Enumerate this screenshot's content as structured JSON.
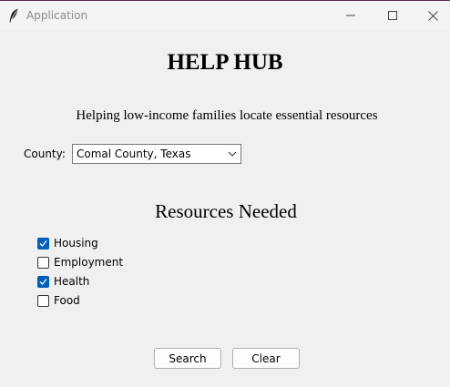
{
  "window": {
    "title": "Application",
    "icons": {
      "app": "feather-icon",
      "minimize": "minimize-icon",
      "maximize": "maximize-icon",
      "close": "close-icon"
    }
  },
  "header": {
    "title": "HELP HUB",
    "subtitle": "Helping low-income families locate essential resources"
  },
  "county": {
    "label": "County:",
    "selected": "Comal County, Texas"
  },
  "resources": {
    "title": "Resources Needed",
    "items": [
      {
        "label": "Housing",
        "checked": true
      },
      {
        "label": "Employment",
        "checked": false
      },
      {
        "label": "Health",
        "checked": true
      },
      {
        "label": "Food",
        "checked": false
      }
    ]
  },
  "actions": {
    "search_label": "Search",
    "clear_label": "Clear"
  },
  "colors": {
    "checkbox_checked": "#005fb8",
    "background": "#f0f0f0"
  }
}
